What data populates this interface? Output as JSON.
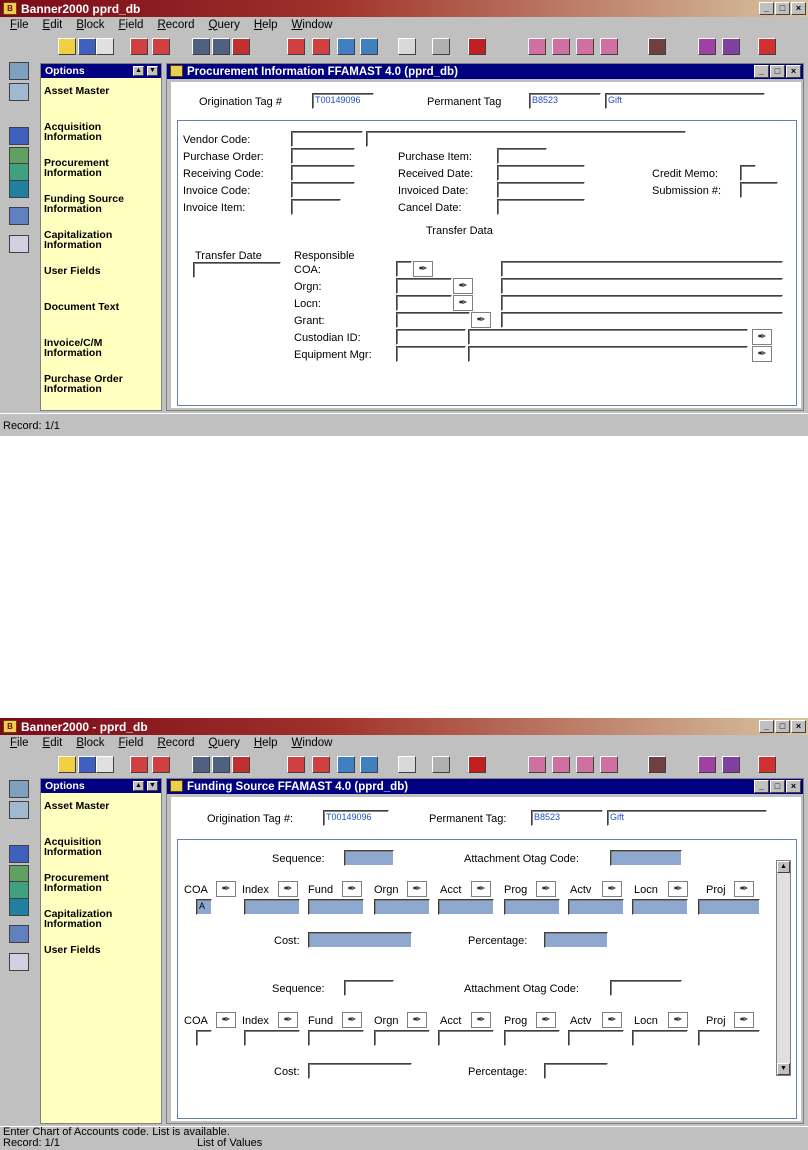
{
  "screen1": {
    "app_title": "Banner2000 pprd_db",
    "menu": [
      "File",
      "Edit",
      "Block",
      "Field",
      "Record",
      "Query",
      "Help",
      "Window"
    ],
    "options_title": "Options",
    "options": [
      "Asset Master",
      "Acquisition Information",
      "Procurement Information",
      "Funding Source Information",
      "Capitalization Information",
      "User Fields",
      "Document Text",
      "Invoice/C/M Information",
      "Purchase Order Information"
    ],
    "form_title": "Procurement Information FFAMAST 4.0 (pprd_db)",
    "origination_tag_label": "Origination Tag #",
    "origination_tag_value": "T00149096",
    "permanent_tag_label": "Permanent Tag",
    "permanent_tag_value": "B8523",
    "gift_value": "Gift",
    "vendor_code_label": "Vendor Code:",
    "purchase_order_label": "Purchase Order:",
    "purchase_item_label": "Purchase Item:",
    "receiving_code_label": "Receiving Code:",
    "received_date_label": "Received Date:",
    "credit_memo_label": "Credit Memo:",
    "invoice_code_label": "Invoice Code:",
    "invoiced_date_label": "Invoiced Date:",
    "submission_label": "Submission #:",
    "invoice_item_label": "Invoice Item:",
    "cancel_date_label": "Cancel Date:",
    "transfer_data_label": "Transfer Data",
    "transfer_date_label": "Transfer Date",
    "responsible_label": "Responsible",
    "coa_label": "COA:",
    "orgn_label": "Orgn:",
    "locn_label": "Locn:",
    "grant_label": "Grant:",
    "custodian_label": "Custodian ID:",
    "equipment_mgr_label": "Equipment Mgr:",
    "status_record": "Record: 1/1"
  },
  "screen2": {
    "app_title": "Banner2000 - pprd_db",
    "menu": [
      "File",
      "Edit",
      "Block",
      "Field",
      "Record",
      "Query",
      "Help",
      "Window"
    ],
    "options_title": "Options",
    "options": [
      "Asset Master",
      "Acquisition Information",
      "Procurement Information",
      "Capitalization Information",
      "User Fields"
    ],
    "form_title": "Funding Source FFAMAST 4.0 (pprd_db)",
    "origination_tag_label": "Origination Tag #:",
    "origination_tag_value": "T00149096",
    "permanent_tag_label": "Permanent Tag:",
    "permanent_tag_value": "B8523",
    "gift_value": "Gift",
    "sequence_label": "Sequence:",
    "attachment_label_1": "Attachment Otag Code:",
    "attachment_label_2": "Attachment Otag Code:",
    "coa_value": "A",
    "columns": [
      "COA",
      "Index",
      "Fund",
      "Orgn",
      "Acct",
      "Prog",
      "Actv",
      "Locn",
      "Proj"
    ],
    "cost_label": "Cost:",
    "percentage_label": "Percentage:",
    "status_message": "Enter Chart of Accounts code. List is available.",
    "status_record": "Record: 1/1",
    "status_lov": "List of Values"
  }
}
